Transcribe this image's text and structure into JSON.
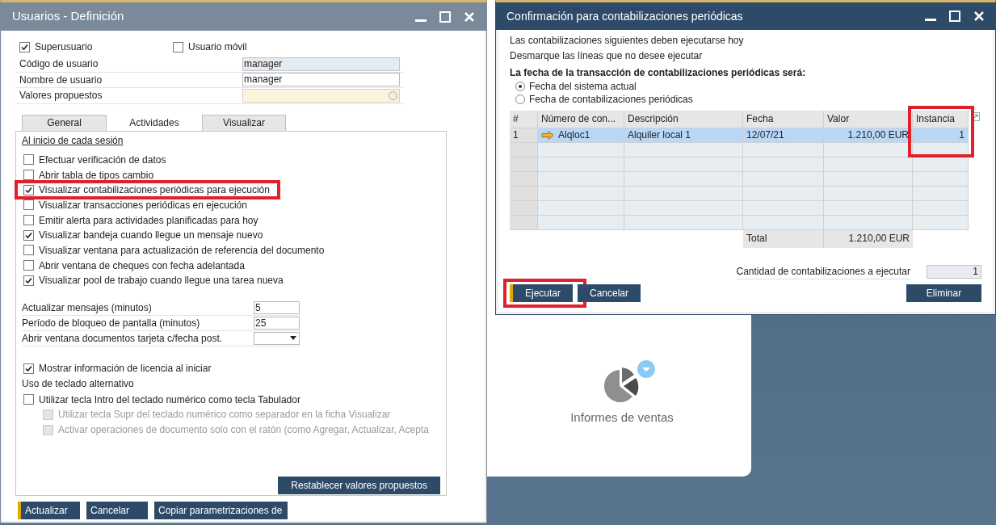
{
  "background_card": {
    "label": "Informes de ventas"
  },
  "user_window": {
    "title": "Usuarios - Definición",
    "top_checks": [
      {
        "label": "Superusuario",
        "checked": true
      },
      {
        "label": "Usuario móvil",
        "checked": false
      }
    ],
    "fields": [
      {
        "label": "Código de usuario",
        "value": "manager",
        "kind": "readonly"
      },
      {
        "label": "Nombre de usuario",
        "value": "manager",
        "kind": "text"
      },
      {
        "label": "Valores propuestos",
        "kind": "lookup"
      }
    ],
    "tabs": [
      {
        "label": "General",
        "selected": false
      },
      {
        "label": "Actividades",
        "selected": true
      },
      {
        "label": "Visualizar",
        "selected": false
      }
    ],
    "section_title": "Al inicio de cada sesión",
    "options": [
      {
        "label": "Efectuar verificación de datos",
        "checked": false
      },
      {
        "label": "Abrir tabla de tipos cambio",
        "checked": false
      },
      {
        "label": "Visualizar contabilizaciones periódicas para ejecución",
        "checked": true,
        "highlighted": true
      },
      {
        "label": "Visualizar transacciones periódicas en ejecución",
        "checked": false
      },
      {
        "label": "Emitir alerta para actividades planificadas para hoy",
        "checked": false
      },
      {
        "label": "Visualizar bandeja cuando llegue un mensaje nuevo",
        "checked": true
      },
      {
        "label": "Visualizar ventana para actualización de referencia del documento",
        "checked": false
      },
      {
        "label": "Abrir ventana de cheques con fecha adelantada",
        "checked": false
      },
      {
        "label": "Visualizar pool de trabajo cuando llegue una tarea nueva",
        "checked": true
      }
    ],
    "settings": [
      {
        "label": "Actualizar mensajes (minutos)",
        "value": "5",
        "kind": "text"
      },
      {
        "label": "Período de bloqueo de pantalla (minutos)",
        "value": "25",
        "kind": "text"
      },
      {
        "label": "Abrir ventana documentos tarjeta c/fecha post.",
        "kind": "dropdown"
      }
    ],
    "license_check": {
      "label": "Mostrar información de licencia al iniciar",
      "checked": true
    },
    "keyboard_title": "Uso de teclado alternativo",
    "keyboard_options": [
      {
        "label": "Utilizar tecla Intro del teclado numérico como tecla Tabulador",
        "checked": false,
        "disabled": false
      },
      {
        "label": "Utilizar tecla Supr del teclado numérico como separador en la ficha Visualizar",
        "checked": false,
        "disabled": true
      },
      {
        "label": "Activar operaciones de documento solo con el ratón (como Agregar, Actualizar, Acepta",
        "checked": false,
        "disabled": true
      }
    ],
    "reset_button": "Restablecer valores propuestos",
    "buttons": [
      {
        "label": "Actualizar",
        "primary": true
      },
      {
        "label": "Cancelar",
        "primary": false
      },
      {
        "label": "Copiar parametrizaciones de",
        "primary": false
      }
    ]
  },
  "confirm_window": {
    "title": "Confirmación para contabilizaciones periódicas",
    "lines": [
      "Las contabilizaciones siguientes deben ejecutarse hoy",
      "Desmarque las líneas que no desee ejecutar"
    ],
    "date_heading": "La fecha de la transacción de contabilizaciones periódicas será:",
    "date_options": [
      {
        "label": "Fecha del sistema actual",
        "selected": true
      },
      {
        "label": "Fecha de contabilizaciones periódicas",
        "selected": false
      }
    ],
    "table": {
      "columns": [
        "#",
        "Número de con...",
        "Descripción",
        "Fecha",
        "Valor",
        "Instancia"
      ],
      "rows": [
        {
          "cells": [
            "1",
            "Alqloc1",
            "Alquiler local 1",
            "12/07/21",
            "1.210,00 EUR",
            "1"
          ],
          "selected": true
        }
      ],
      "total_label": "Total",
      "total_value": "1.210,00 EUR"
    },
    "count_label": "Cantidad de contabilizaciones a ejecutar",
    "count_value": "1",
    "buttons": [
      {
        "label": "Ejecutar",
        "primary": true,
        "highlighted": true
      },
      {
        "label": "Cancelar",
        "primary": false,
        "highlighted": false
      }
    ],
    "delete_button": "Eliminar"
  }
}
